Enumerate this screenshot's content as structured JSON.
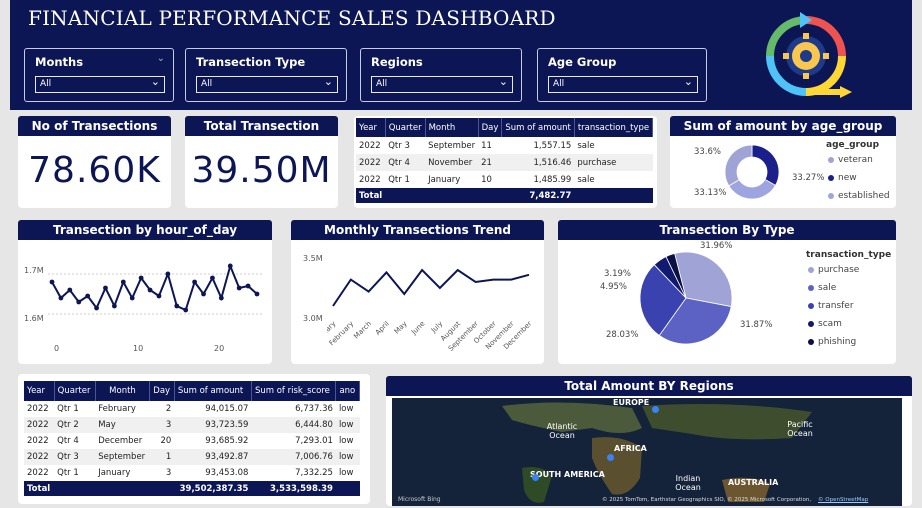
{
  "header": {
    "title": "FINANCIAL PERFORMANCE SALES  DASHBOARD"
  },
  "slicers": [
    {
      "label": "Months",
      "value": "All"
    },
    {
      "label": "Transection Type",
      "value": "All"
    },
    {
      "label": "Regions",
      "value": "All"
    },
    {
      "label": "Age Group",
      "value": "All"
    }
  ],
  "kpis": {
    "transactions": {
      "label": "No of Transections",
      "value": "78.60K"
    },
    "total": {
      "label": "Total Transection",
      "value": "39.50M"
    }
  },
  "table1": {
    "headers": [
      "Year",
      "Quarter",
      "Month",
      "Day",
      "Sum of amount",
      "transaction_type"
    ],
    "rows": [
      [
        "2022",
        "Qtr 3",
        "September",
        "11",
        "1,557.15",
        "sale"
      ],
      [
        "2022",
        "Qtr 4",
        "November",
        "21",
        "1,516.46",
        "purchase"
      ],
      [
        "2022",
        "Qtr 1",
        "January",
        "10",
        "1,485.99",
        "sale"
      ]
    ],
    "total_label": "Total",
    "total_value": "7,482.77"
  },
  "age_group_chart": {
    "title": "Sum of amount by age_group",
    "legend_title": "age_group",
    "slices": [
      {
        "name": "veteran",
        "pct": "33.6%",
        "value": 33.6,
        "color": "#9fa3d6"
      },
      {
        "name": "new",
        "pct": "33.27%",
        "value": 33.27,
        "color": "#1b1f8c"
      },
      {
        "name": "established",
        "pct": "33.13%",
        "value": 33.13,
        "color": "#9ea4e0"
      }
    ]
  },
  "hour_chart": {
    "title": "Transection by hour_of_day",
    "y_ticks": [
      "1.7M",
      "1.6M"
    ],
    "x_ticks": [
      "0",
      "10",
      "20"
    ],
    "chart_data": {
      "type": "line",
      "x": [
        0,
        1,
        2,
        3,
        4,
        5,
        6,
        7,
        8,
        9,
        10,
        11,
        12,
        13,
        14,
        15,
        16,
        17,
        18,
        19,
        20,
        21,
        22,
        23
      ],
      "values": [
        1.68,
        1.64,
        1.66,
        1.63,
        1.645,
        1.615,
        1.665,
        1.62,
        1.68,
        1.64,
        1.69,
        1.66,
        1.645,
        1.7,
        1.62,
        1.61,
        1.68,
        1.65,
        1.69,
        1.64,
        1.72,
        1.665,
        1.67,
        1.65
      ],
      "ylim": [
        1.55,
        1.75
      ]
    }
  },
  "monthly_chart": {
    "title": "Monthly Transections Trend",
    "y_ticks": [
      "3.5M",
      "3.0M"
    ],
    "months": [
      "January",
      "February",
      "March",
      "April",
      "May",
      "June",
      "July",
      "August",
      "September",
      "October",
      "November",
      "December"
    ],
    "chart_data": {
      "type": "line",
      "values": [
        3.1,
        3.32,
        3.22,
        3.38,
        3.2,
        3.4,
        3.25,
        3.4,
        3.3,
        3.32,
        3.32,
        3.36
      ],
      "ylim": [
        3.0,
        3.5
      ]
    }
  },
  "type_chart": {
    "title": "Transection By Type",
    "legend_title": "transaction_type",
    "slices": [
      {
        "name": "purchase",
        "pct": "31.96%",
        "value": 31.96,
        "color": "#9fa3d6"
      },
      {
        "name": "sale",
        "pct": "31.87%",
        "value": 31.87,
        "color": "#5b62c4"
      },
      {
        "name": "transfer",
        "pct": "28.03%",
        "value": 28.03,
        "color": "#3a42b0"
      },
      {
        "name": "scam",
        "pct": "4.95%",
        "value": 4.95,
        "color": "#111a6e"
      },
      {
        "name": "phishing",
        "pct": "3.19%",
        "value": 3.19,
        "color": "#0a0f44"
      }
    ]
  },
  "table2": {
    "headers": [
      "Year",
      "Quarter",
      "Month",
      "Day",
      "Sum of amount",
      "Sum of risk_score",
      "ano"
    ],
    "rows": [
      [
        "2022",
        "Qtr 1",
        "February",
        "2",
        "94,015.07",
        "6,737.36",
        "low"
      ],
      [
        "2022",
        "Qtr 2",
        "May",
        "3",
        "93,723.59",
        "6,444.80",
        "low"
      ],
      [
        "2022",
        "Qtr 4",
        "December",
        "20",
        "93,685.92",
        "7,293.01",
        "low"
      ],
      [
        "2022",
        "Qtr 3",
        "September",
        "1",
        "93,492.87",
        "7,006.76",
        "low"
      ],
      [
        "2022",
        "Qtr 1",
        "January",
        "3",
        "93,453.08",
        "7,332.25",
        "low"
      ]
    ],
    "total_label": "Total",
    "total_amount": "39,502,387.35",
    "total_risk": "3,533,598.39"
  },
  "map": {
    "title": "Total Amount BY Regions",
    "labels": [
      "EUROPE",
      "Atlantic Ocean",
      "AFRICA",
      "SOUTH AMERICA",
      "Indian Ocean",
      "AUSTRALIA",
      "Pacific Ocean"
    ],
    "attribution": "© 2025 TomTom, Earthstar Geographics SIO, © 2025 Microsoft Corporation,",
    "osm": "© OpenStreetMap",
    "bing": "Microsoft Bing"
  },
  "colors": {
    "navy": "#0d1655",
    "background": "#e6e6e6"
  },
  "icons": [
    "chevron-down-icon",
    "dropdown-arrow-icon",
    "gear-cycle-logo-icon",
    "map-marker-icon"
  ]
}
